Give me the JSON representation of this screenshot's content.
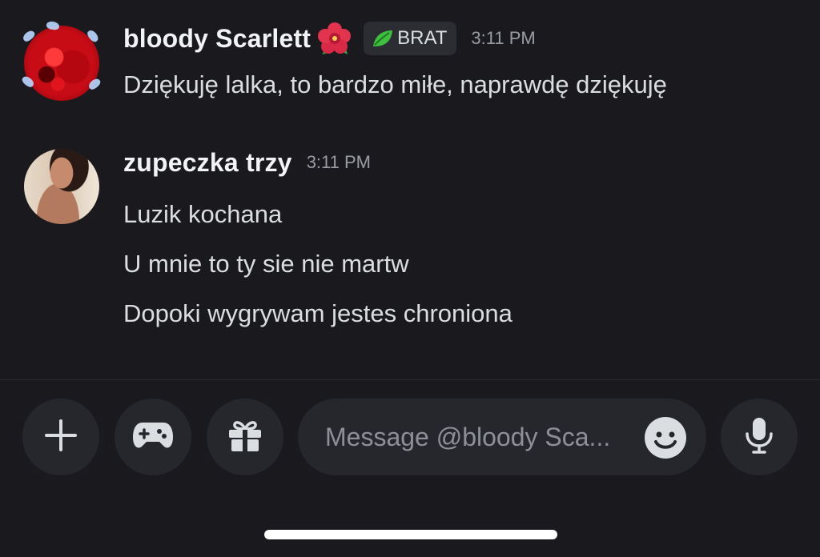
{
  "messages": [
    {
      "username": "bloody Scarlett",
      "username_emoji": "hibiscus-icon",
      "role_badge": {
        "icon": "leaf-icon",
        "label": "BRAT"
      },
      "timestamp": "3:11 PM",
      "lines": [
        "Dziękuję lalka, to bardzo miłe, naprawdę dziękuję"
      ]
    },
    {
      "username": "zupeczka trzy",
      "timestamp": "3:11 PM",
      "lines": [
        "Luzik kochana",
        "U mnie to ty sie nie martw",
        "Dopoki wygrywam jestes chroniona"
      ]
    }
  ],
  "composer": {
    "add_icon": "plus-icon",
    "game_icon": "gamepad-icon",
    "gift_icon": "gift-icon",
    "input_placeholder": "Message @bloody Sca...",
    "emoji_icon": "smiley-icon",
    "mic_icon": "microphone-icon"
  },
  "colors": {
    "background": "#1a1a1e",
    "surface": "#26272c",
    "badge_background": "#2b2d33",
    "text_primary": "#f2f3f5",
    "text_secondary": "#dbdee1",
    "timestamp": "#9a9ca3",
    "leaf_green": "#3fbf3f",
    "flower_red": "#e2344f"
  }
}
